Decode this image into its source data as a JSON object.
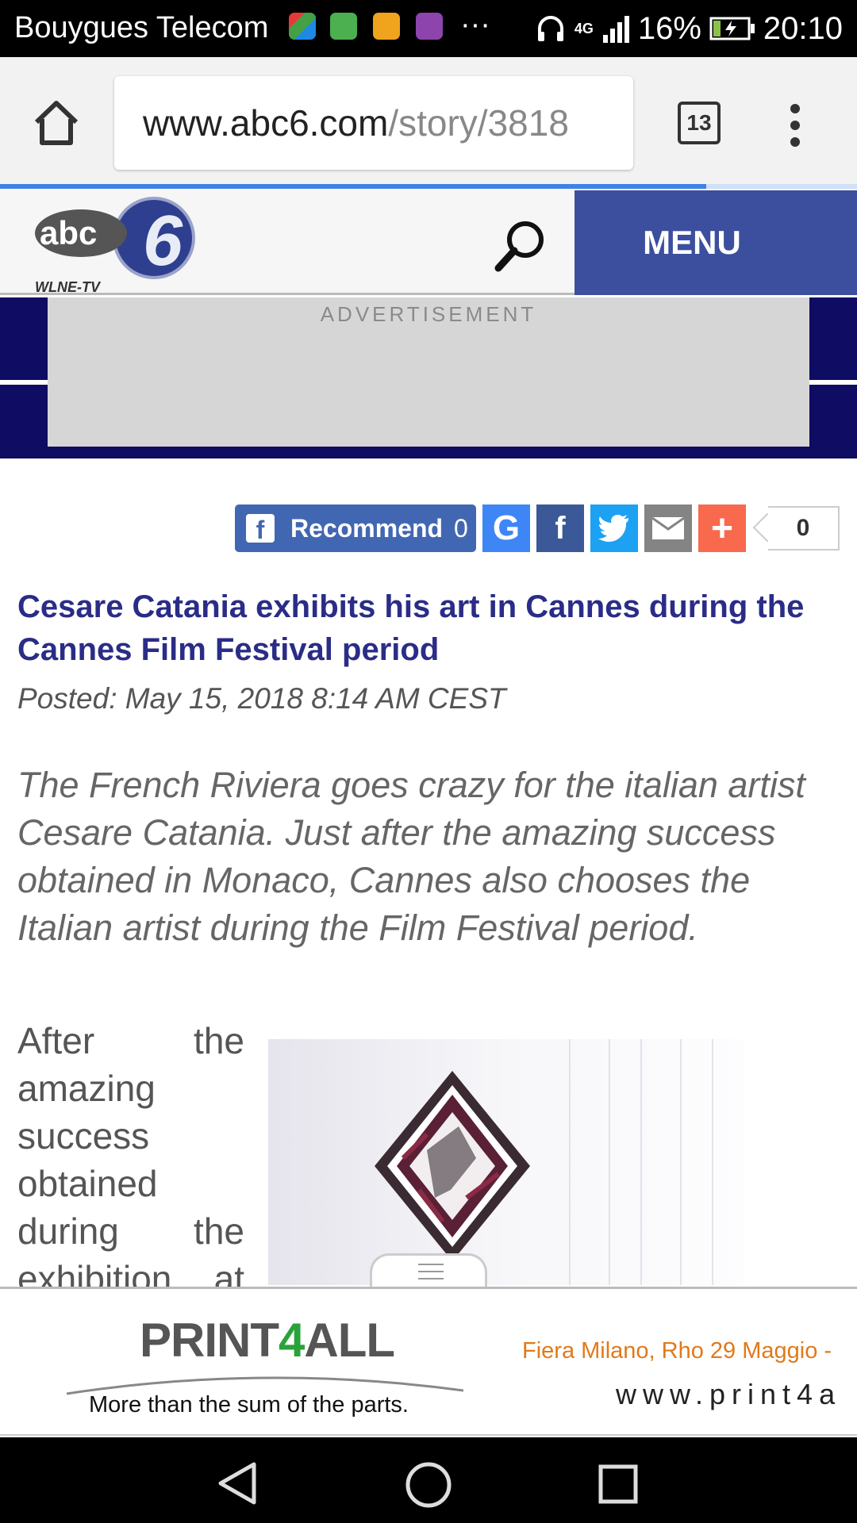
{
  "status_bar": {
    "carrier": "Bouygues Telecom",
    "overflow": "···",
    "network": "4G",
    "battery": "16%",
    "time": "20:10"
  },
  "browser": {
    "url_domain": "www.abc6.com",
    "url_path": "/story/3818",
    "tab_count": "13"
  },
  "site": {
    "logo_text": "abc",
    "logo_number": "6",
    "logo_callsign": "WLNE-TV",
    "menu_label": "MENU",
    "ad_label": "ADVERTISEMENT"
  },
  "share": {
    "recommend_label": "Recommend",
    "recommend_count": "0",
    "share_total": "0",
    "buttons": [
      {
        "name": "google",
        "color": "#3e86f5"
      },
      {
        "name": "facebook",
        "color": "#3b5998"
      },
      {
        "name": "twitter",
        "color": "#1da1f2"
      },
      {
        "name": "email",
        "color": "#848484"
      },
      {
        "name": "more",
        "color": "#f8694d"
      }
    ]
  },
  "article": {
    "headline": "Cesare Catania exhibits his art in Cannes during the Cannes Film Festival period",
    "posted": "Posted: May 15, 2018 8:14 AM CEST",
    "lede": "The French Riviera goes crazy for the italian artist Cesare Catania. Just after the amazing success obtained in Monaco, Cannes also chooses the Italian artist during the Film Festival period.",
    "body": "After the amazing success obtained during the exhibition at"
  },
  "bottom_ad": {
    "brand_a": "PRINT",
    "brand_b": "4",
    "brand_c": "ALL",
    "tagline": "More than the sum of the parts.",
    "event": "Fiera Milano, Rho 29 Maggio -",
    "url": "www.print4a"
  },
  "colors": {
    "menu_bg": "#3c4f9e",
    "headline": "#2a2c87",
    "ad_band": "#0e0d63",
    "recommend_bg": "#4267b2"
  }
}
